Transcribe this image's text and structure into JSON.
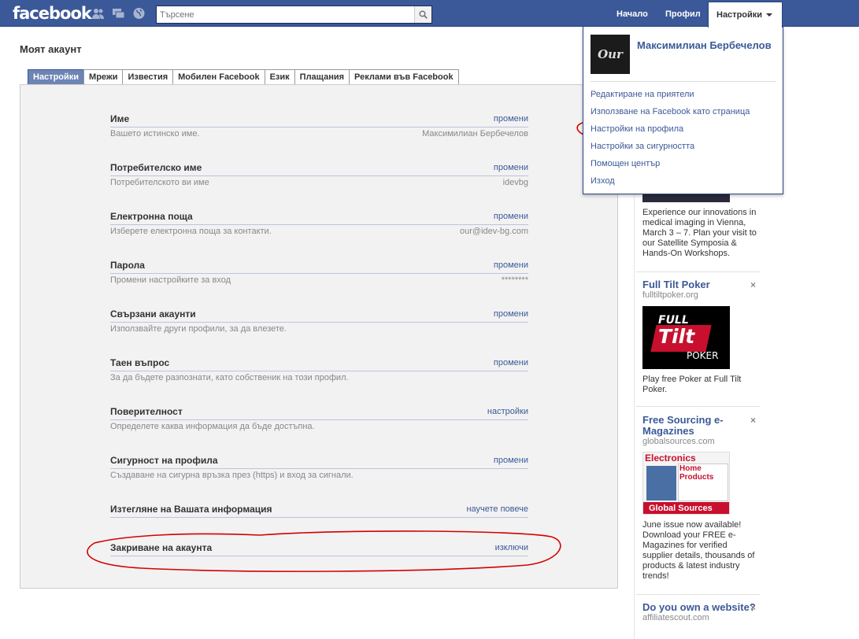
{
  "header": {
    "logo": "facebook",
    "search_placeholder": "Търсене",
    "nav": {
      "home": "Начало",
      "profile": "Профил",
      "settings": "Настройки"
    }
  },
  "account_menu": {
    "avatar_text": "Our",
    "user_name": "Максимилиан Бербечелов",
    "items": [
      "Редактиране на приятели",
      "Използване на Facebook като страница",
      "Настройки на профила",
      "Настройки за сигурността",
      "Помощен център",
      "Изход"
    ]
  },
  "page": {
    "title": "Моят акаунт",
    "tabs": [
      "Настройки",
      "Мрежи",
      "Известия",
      "Мобилен Facebook",
      "Език",
      "Плащания",
      "Реклами във Facebook"
    ],
    "active_tab": "Настройки"
  },
  "settings": [
    {
      "title": "Име",
      "action": "промени",
      "desc": "Вашето истинско име.",
      "value": "Максимилиан Бербечелов"
    },
    {
      "title": "Потребителско име",
      "action": "промени",
      "desc": "Потребителското ви име",
      "value": "idevbg"
    },
    {
      "title": "Електронна поща",
      "action": "промени",
      "desc": "Изберете електронна поща за контакти.",
      "value": "our@idev-bg.com"
    },
    {
      "title": "Парола",
      "action": "промени",
      "desc": "Промени настройките за вход",
      "value": "********"
    },
    {
      "title": "Свързани акаунти",
      "action": "промени",
      "desc": "Използвайте други профили, за да влезете.",
      "value": ""
    },
    {
      "title": "Таен въпрос",
      "action": "промени",
      "desc": "За да бъдете разпознати, като собственик на този профил.",
      "value": ""
    },
    {
      "title": "Поверителност",
      "action": "настройки",
      "desc": "Определете каква информация да бъде достъпна.",
      "value": ""
    },
    {
      "title": "Сигурност на профила",
      "action": "промени",
      "desc": "Създаване на сигурна връзка през (https) и вход за сигнали.",
      "value": ""
    },
    {
      "title": "Изтегляне на Вашата информация",
      "action": "научете повече",
      "desc": "",
      "value": ""
    },
    {
      "title": "Закриване на акаунта",
      "action": "изключи",
      "desc": "",
      "value": ""
    }
  ],
  "ads": [
    {
      "title": "",
      "domain": "",
      "body": "Experience our innovations in medical imaging in Vienna, March 3 – 7. Plan your visit to our Satellite Symposia & Hands-On Workshops."
    },
    {
      "title": "Full Tilt Poker",
      "domain": "fulltiltpoker.org",
      "img_text_1": "FULL",
      "img_text_2": "Tilt",
      "img_text_3": "POKER",
      "body": "Play free Poker at Full Tilt Poker."
    },
    {
      "title": "Free Sourcing e-Magazines",
      "domain": "globalsources.com",
      "img_text_1": "Electronics",
      "img_text_2": "Home Products",
      "img_text_3": "Global Sources",
      "body": "June issue now available! Download your FREE e-Magazines for verified supplier details, thousands of products & latest industry trends!"
    },
    {
      "title": "Do you own a website?",
      "domain": "affiliatescout.com",
      "body": ""
    }
  ],
  "colors": {
    "brand": "#3b5998",
    "annotation": "#d40000"
  }
}
